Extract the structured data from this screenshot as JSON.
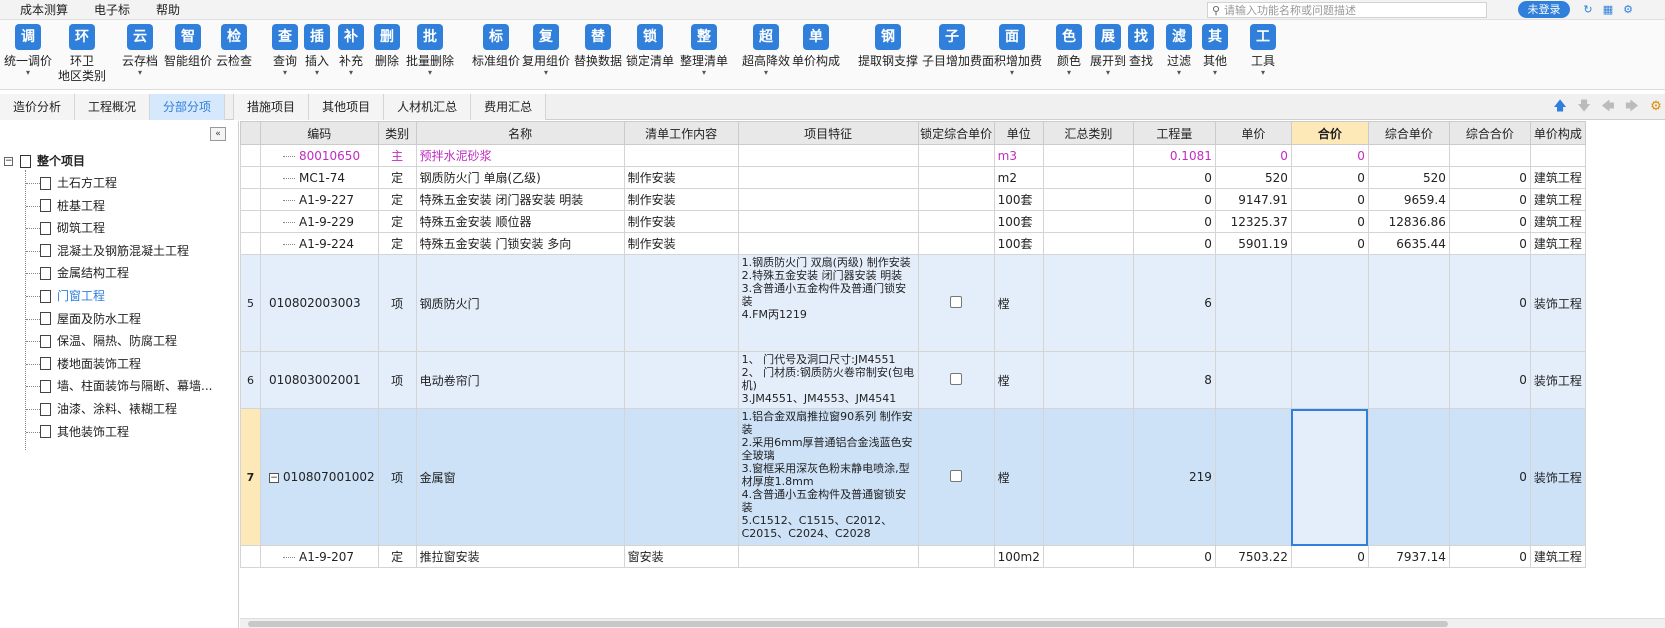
{
  "menubar": {
    "items": [
      "成本测算",
      "电子标",
      "帮助"
    ]
  },
  "search": {
    "placeholder": "请输入功能名称或问题描述"
  },
  "login_label": "未登录",
  "toolbar": {
    "tools": [
      {
        "label": "统一调价",
        "icon": "调",
        "arrow": true
      },
      {
        "label": "环卫\n地区类别",
        "icon": "环",
        "arrow": false
      },
      {
        "label": "云存档",
        "icon": "云",
        "arrow": true
      },
      {
        "label": "智能组价",
        "icon": "智",
        "arrow": false
      },
      {
        "label": "云检查",
        "icon": "检",
        "arrow": false
      },
      {
        "label": "查询",
        "icon": "查",
        "arrow": true
      },
      {
        "label": "插入",
        "icon": "插",
        "arrow": true
      },
      {
        "label": "补充",
        "icon": "补",
        "arrow": true
      },
      {
        "label": "删除",
        "icon": "删",
        "arrow": false
      },
      {
        "label": "批量删除",
        "icon": "批",
        "arrow": true
      },
      {
        "label": "标准组价",
        "icon": "标",
        "arrow": false
      },
      {
        "label": "复用组价",
        "icon": "复",
        "arrow": true
      },
      {
        "label": "替换数据",
        "icon": "替",
        "arrow": false
      },
      {
        "label": "锁定清单",
        "icon": "锁",
        "arrow": false
      },
      {
        "label": "整理清单",
        "icon": "整",
        "arrow": true
      },
      {
        "label": "超高降效",
        "icon": "超",
        "arrow": true
      },
      {
        "label": "单价构成",
        "icon": "单",
        "arrow": false
      },
      {
        "label": "提取钢支撑",
        "icon": "钢",
        "arrow": false
      },
      {
        "label": "子目增加费",
        "icon": "子",
        "arrow": false
      },
      {
        "label": "面积增加费",
        "icon": "面",
        "arrow": true
      },
      {
        "label": "颜色",
        "icon": "色",
        "arrow": true
      },
      {
        "label": "展开到",
        "icon": "展",
        "arrow": true
      },
      {
        "label": "查找",
        "icon": "找",
        "arrow": false
      },
      {
        "label": "过滤",
        "icon": "滤",
        "arrow": true
      },
      {
        "label": "其他",
        "icon": "其",
        "arrow": true
      },
      {
        "label": "工具",
        "icon": "工",
        "arrow": true
      }
    ]
  },
  "tabs": [
    "造价分析",
    "工程概况",
    "分部分项",
    "措施项目",
    "其他项目",
    "人材机汇总",
    "费用汇总"
  ],
  "active_tab": "分部分项",
  "tree": {
    "root": "整个项目",
    "items": [
      "土石方工程",
      "桩基工程",
      "砌筑工程",
      "混凝土及钢筋混凝土工程",
      "金属结构工程",
      "门窗工程",
      "屋面及防水工程",
      "保温、隔热、防腐工程",
      "楼地面装饰工程",
      "墙、柱面装饰与隔断、幕墙...",
      "油漆、涂料、裱糊工程",
      "其他装饰工程"
    ],
    "selected": "门窗工程"
  },
  "grid": {
    "columns": [
      "",
      "编码",
      "类别",
      "名称",
      "清单工作内容",
      "项目特征",
      "锁定综合单价",
      "单位",
      "汇总类别",
      "工程量",
      "单价",
      "合价",
      "综合单价",
      "综合合价",
      "单价构成"
    ],
    "rows": [
      {
        "rn": "",
        "code": "80010650",
        "type": "主",
        "name": "预拌水泥砂浆",
        "work": "",
        "feature": "",
        "unit": "m3",
        "qty": "0.1081",
        "price": "0",
        "total": "0",
        "uprice": "",
        "utotal": "",
        "comp": "",
        "style": "pink"
      },
      {
        "rn": "",
        "code": "MC1-74",
        "type": "定",
        "name": "钢质防火门 单扇(乙级)",
        "work": "制作安装",
        "feature": "",
        "unit": "m2",
        "qty": "0",
        "price": "520",
        "total": "0",
        "uprice": "520",
        "utotal": "0",
        "comp": "建筑工程",
        "style": ""
      },
      {
        "rn": "",
        "code": "A1-9-227",
        "type": "定",
        "name": "特殊五金安装 闭门器安装 明装",
        "work": "制作安装",
        "feature": "",
        "unit": "100套",
        "qty": "0",
        "price": "9147.91",
        "total": "0",
        "uprice": "9659.4",
        "utotal": "0",
        "comp": "建筑工程",
        "style": ""
      },
      {
        "rn": "",
        "code": "A1-9-229",
        "type": "定",
        "name": "特殊五金安装 顺位器",
        "work": "制作安装",
        "feature": "",
        "unit": "100套",
        "qty": "0",
        "price": "12325.37",
        "total": "0",
        "uprice": "12836.86",
        "utotal": "0",
        "comp": "建筑工程",
        "style": ""
      },
      {
        "rn": "",
        "code": "A1-9-224",
        "type": "定",
        "name": "特殊五金安装 门锁安装 多向",
        "work": "制作安装",
        "feature": "",
        "unit": "100套",
        "qty": "0",
        "price": "5901.19",
        "total": "0",
        "uprice": "6635.44",
        "utotal": "0",
        "comp": "建筑工程",
        "style": ""
      },
      {
        "rn": "5",
        "code": "010802003003",
        "type": "项",
        "name": "钢质防火门",
        "work": "",
        "feature": "1.钢质防火门 双扇(丙级) 制作安装\n2.特殊五金安装 闭门器安装 明装\n3.含普通小五金构件及普通门锁安装\n4.FM丙1219",
        "unit": "樘",
        "qty": "6",
        "price": "",
        "total": "",
        "uprice": "",
        "utotal": "0",
        "comp": "装饰工程",
        "style": "blue"
      },
      {
        "rn": "6",
        "code": "010803002001",
        "type": "项",
        "name": "电动卷帘门",
        "work": "",
        "feature": "1、 门代号及洞口尺寸:JM4551\n2、 门材质:钢质防火卷帘制安(包电机)\n3.JM4551、JM4553、JM4541",
        "unit": "樘",
        "qty": "8",
        "price": "",
        "total": "",
        "uprice": "",
        "utotal": "0",
        "comp": "装饰工程",
        "style": "blue"
      },
      {
        "rn": "7",
        "code": "010807001002",
        "type": "项",
        "name": "金属窗",
        "work": "",
        "feature": "1.铝合金双扇推拉窗90系列 制作安装\n2.采用6mm厚普通铝合金浅蓝色安全玻璃\n3.窗框采用深灰色粉末静电喷涂,型材厚度1.8mm\n4.含普通小五金构件及普通窗锁安装\n5.C1512、C1515、C2012、C2015、C2024、C2028",
        "unit": "樘",
        "qty": "219",
        "price": "",
        "total": "",
        "uprice": "",
        "utotal": "0",
        "comp": "装饰工程",
        "style": "selrow"
      },
      {
        "rn": "",
        "code": "A1-9-207",
        "type": "定",
        "name": "推拉窗安装",
        "work": "窗安装",
        "feature": "",
        "unit": "100m2",
        "qty": "0",
        "price": "7503.22",
        "total": "0",
        "uprice": "7937.14",
        "utotal": "0",
        "comp": "建筑工程",
        "style": ""
      }
    ]
  }
}
